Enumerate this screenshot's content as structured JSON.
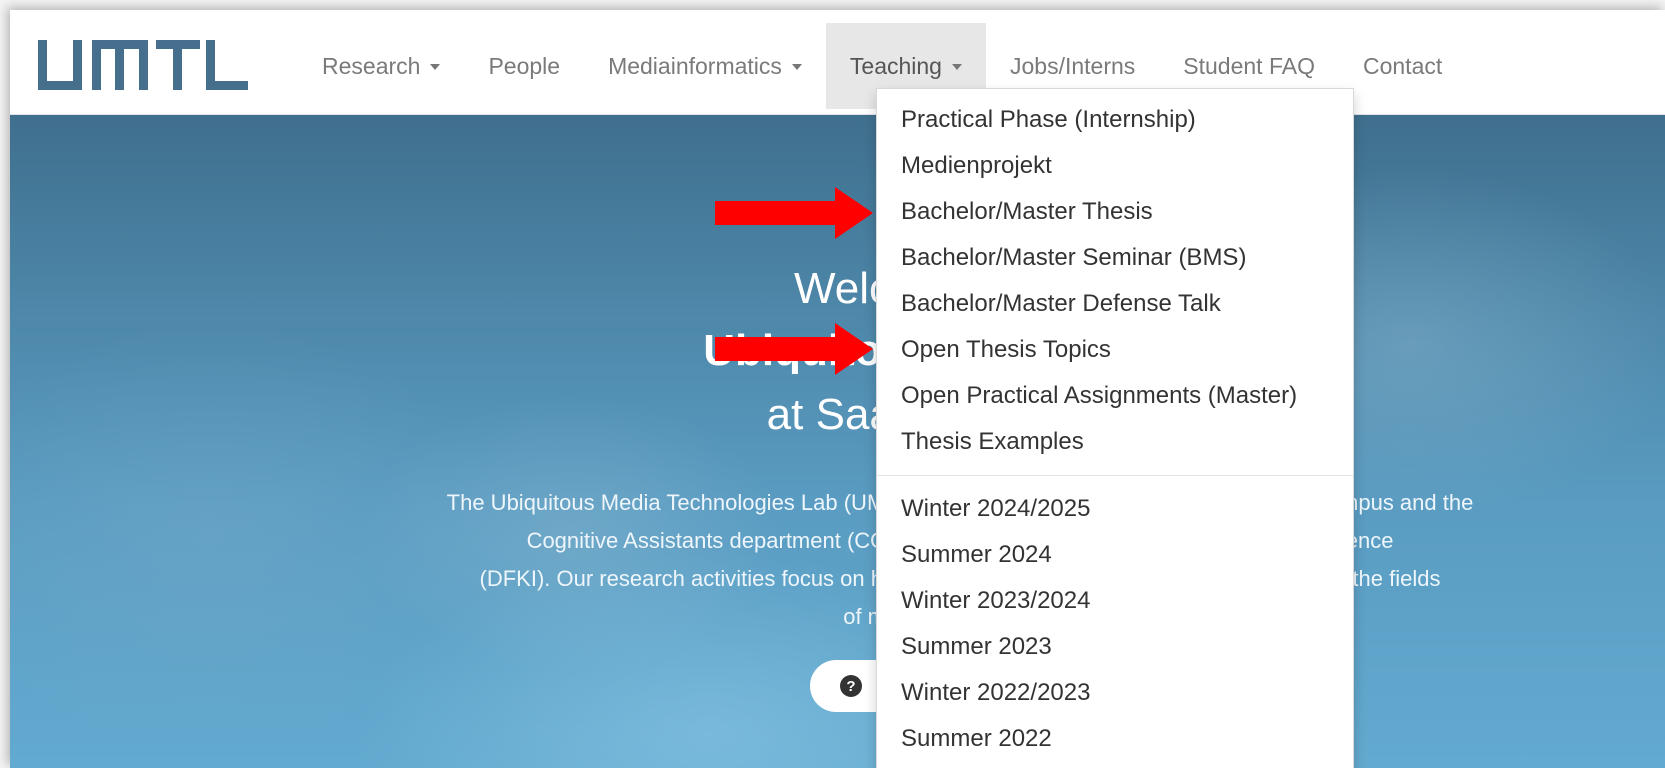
{
  "brand": {
    "logo_text": "UMTL",
    "logo_color": "#466f8e"
  },
  "nav": {
    "items": [
      {
        "label": "Research",
        "has_caret": true
      },
      {
        "label": "People",
        "has_caret": false
      },
      {
        "label": "Mediainformatics",
        "has_caret": true
      },
      {
        "label": "Teaching",
        "has_caret": true,
        "active": true
      },
      {
        "label": "Jobs/Interns",
        "has_caret": false
      },
      {
        "label": "Student FAQ",
        "has_caret": false
      },
      {
        "label": "Contact",
        "has_caret": false
      }
    ]
  },
  "hero": {
    "line1": "Welc",
    "line2": "Ubiquitous M",
    "line3": "at Saarl",
    "paragraph": [
      "The Ubiquitous Media Technologies Lab (UMTL)                                                                     mpus and the",
      "Cognitive Assistants department (COS) a                                                          Intelligence",
      "(DFKI). Our research activities focus on hum                                                               ar, in the fields",
      "of multi-modal interactio"
    ],
    "button_icon": "help-circle-icon"
  },
  "dropdown": {
    "group1": [
      "Practical Phase (Internship)",
      "Medienprojekt",
      "Bachelor/Master Thesis",
      "Bachelor/Master Seminar (BMS)",
      "Bachelor/Master Defense Talk",
      "Open Thesis Topics",
      "Open Practical Assignments (Master)",
      "Thesis Examples"
    ],
    "group2": [
      "Winter 2024/2025",
      "Summer 2024",
      "Winter 2023/2024",
      "Summer 2023",
      "Winter 2022/2023",
      "Summer 2022"
    ]
  },
  "annotations": {
    "arrow_color": "#ff0000"
  }
}
